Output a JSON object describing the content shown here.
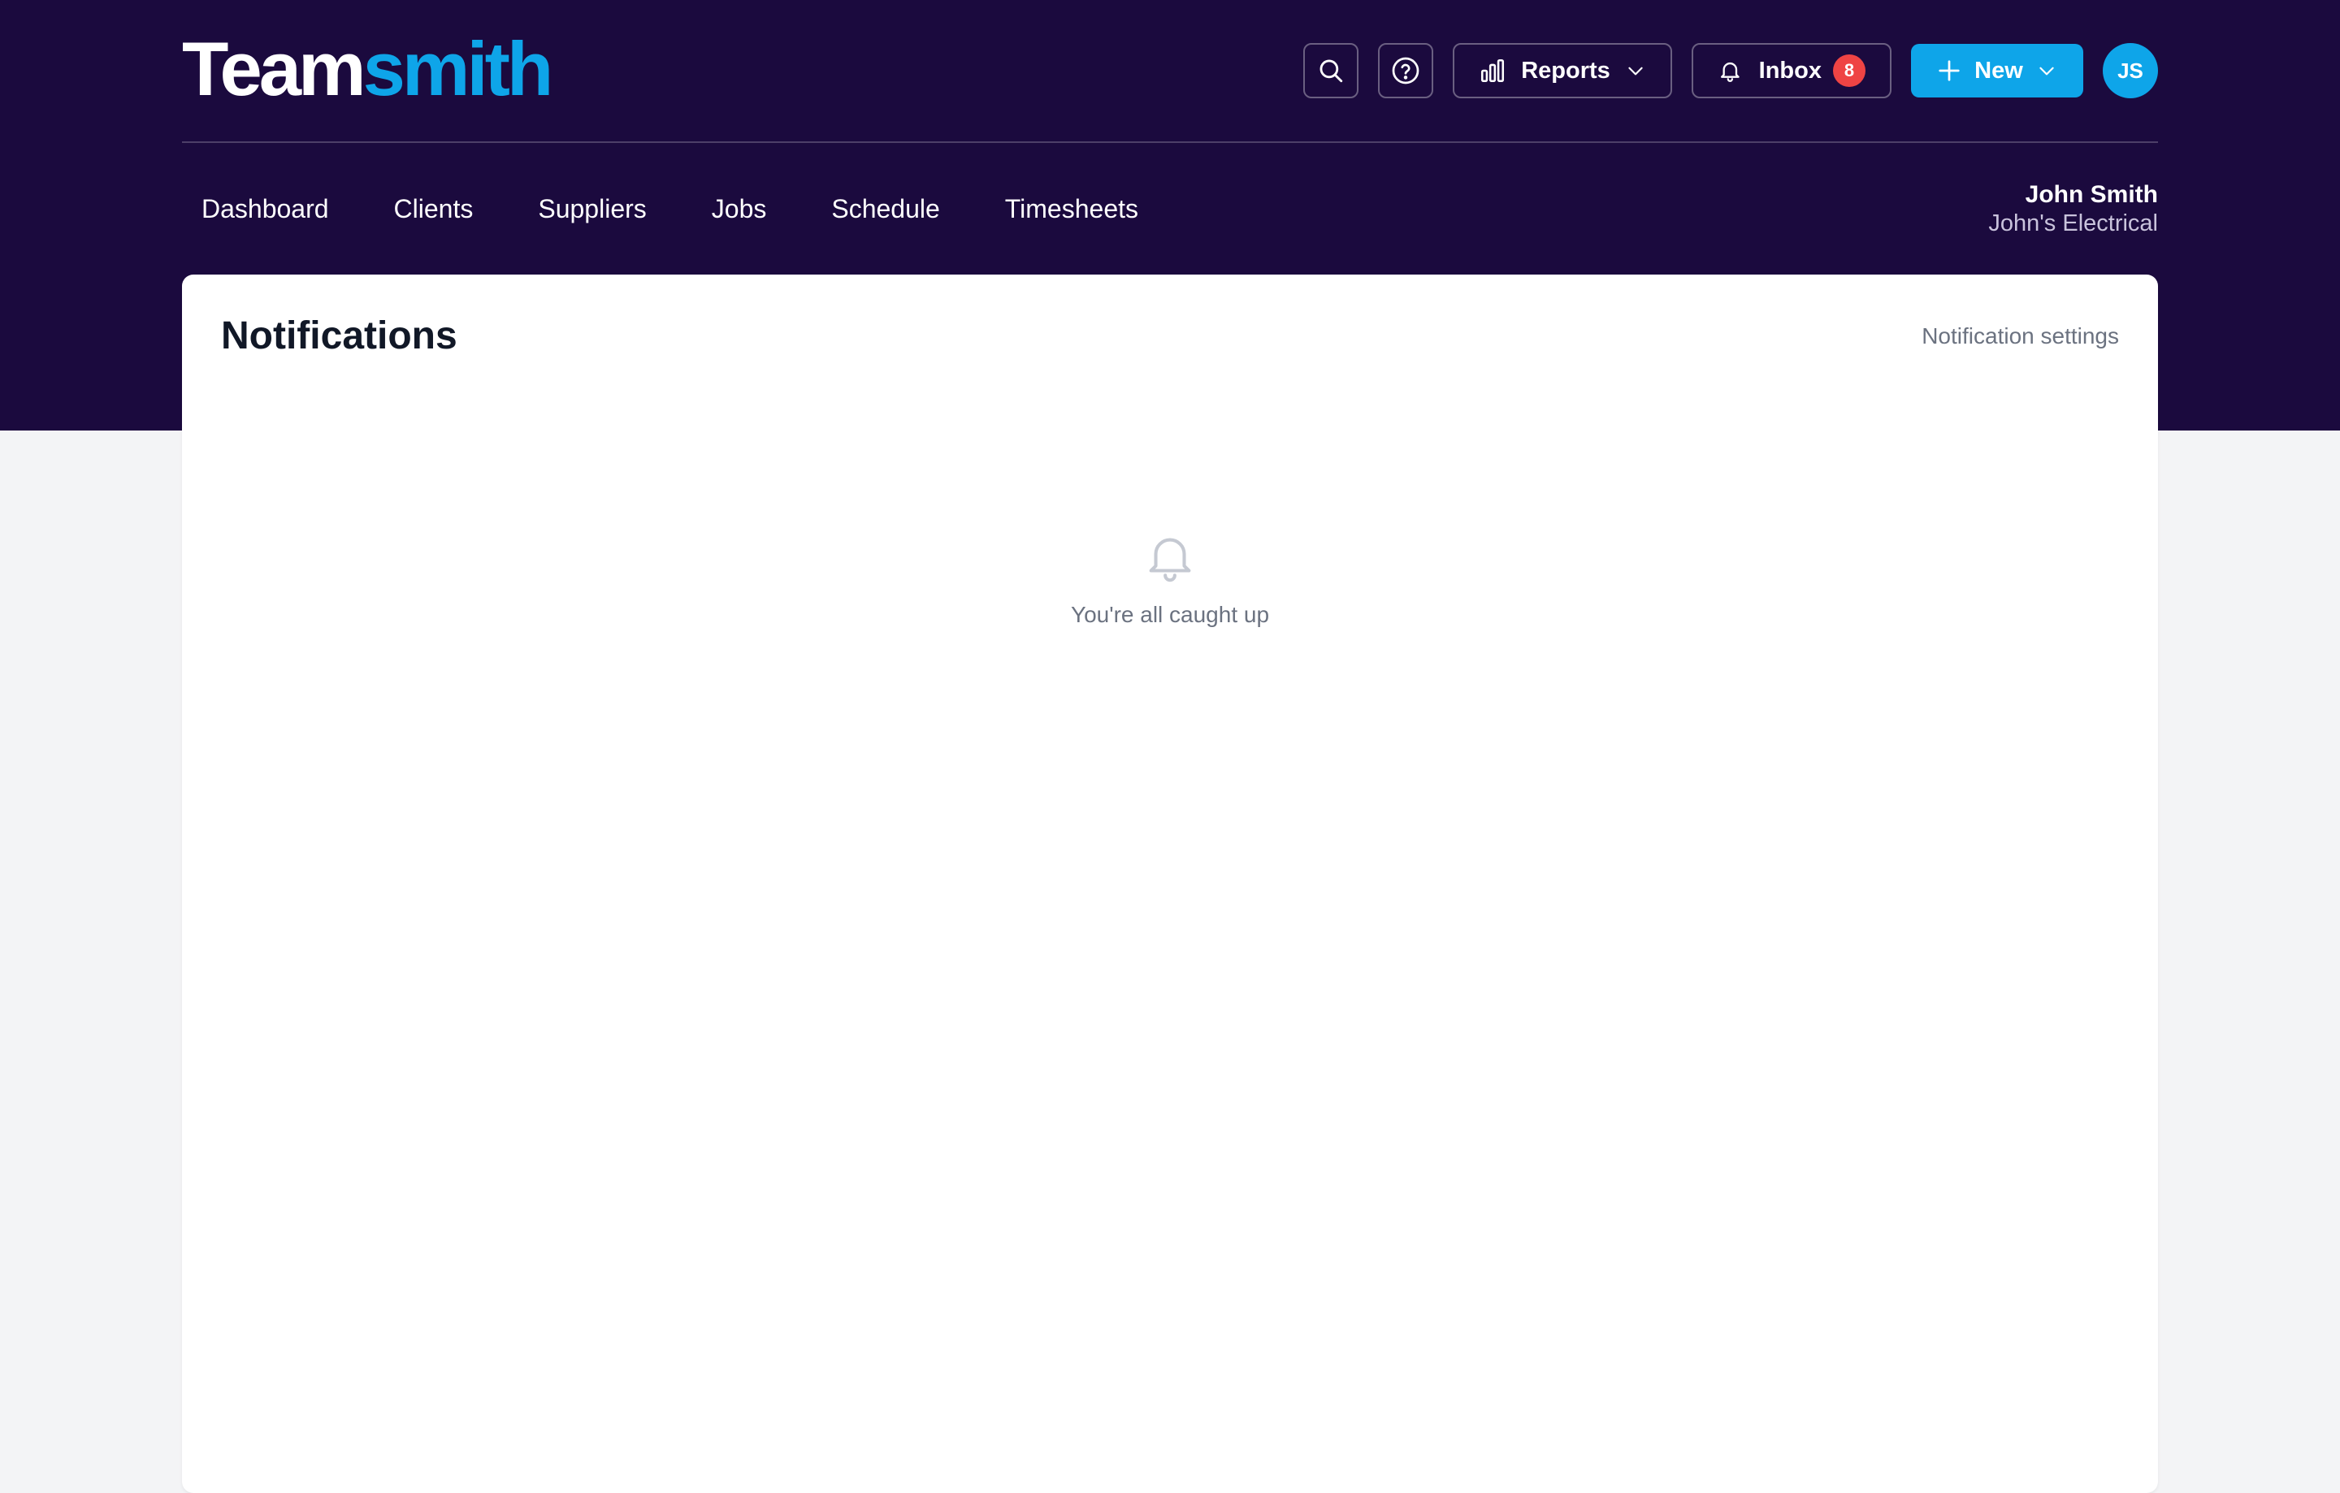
{
  "app": {
    "logo_part_a": "Team",
    "logo_part_b": "smith"
  },
  "header": {
    "reports_label": "Reports",
    "inbox_label": "Inbox",
    "inbox_count": "8",
    "new_label": "New",
    "avatar_initials": "JS"
  },
  "nav": {
    "items": [
      {
        "label": "Dashboard"
      },
      {
        "label": "Clients"
      },
      {
        "label": "Suppliers"
      },
      {
        "label": "Jobs"
      },
      {
        "label": "Schedule"
      },
      {
        "label": "Timesheets"
      }
    ]
  },
  "user": {
    "name": "John Smith",
    "company": "John's Electrical"
  },
  "main": {
    "title": "Notifications",
    "settings_link": "Notification settings",
    "empty_message": "You're all caught up"
  },
  "colors": {
    "header_bg": "#1b0a3e",
    "accent": "#0ea5e9",
    "badge": "#ef4444",
    "page_bg": "#f3f4f6"
  },
  "icons": [
    "search-icon",
    "help-icon",
    "bar-chart-icon",
    "chevron-down-icon",
    "bell-icon",
    "plus-icon"
  ]
}
